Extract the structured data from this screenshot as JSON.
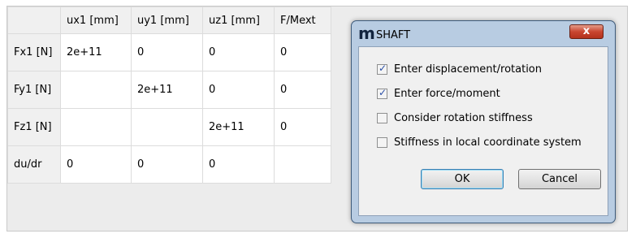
{
  "grid": {
    "columns": [
      "ux1 [mm]",
      "uy1 [mm]",
      "uz1 [mm]",
      "F/Mext"
    ],
    "rows": [
      {
        "label": "Fx1 [N]",
        "cells": [
          "2e+11",
          "0",
          "0",
          "0"
        ]
      },
      {
        "label": "Fy1 [N]",
        "cells": [
          "",
          "2e+11",
          "0",
          "0"
        ]
      },
      {
        "label": "Fz1 [N]",
        "cells": [
          "",
          "",
          "2e+11",
          "0"
        ]
      },
      {
        "label": "du/dr",
        "cells": [
          "0",
          "0",
          "0",
          ""
        ]
      }
    ]
  },
  "dialog": {
    "icon_glyph": "m",
    "title": "SHAFT",
    "close_glyph": "x",
    "options": [
      {
        "label": "Enter displacement/rotation",
        "checked": true
      },
      {
        "label": "Enter force/moment",
        "checked": true
      },
      {
        "label": "Consider rotation stiffness",
        "checked": false
      },
      {
        "label": "Stiffness in local coordinate system",
        "checked": false
      }
    ],
    "ok_label": "OK",
    "cancel_label": "Cancel"
  },
  "colors": {
    "window_frame": "#b8cce2",
    "close_button": "#c94630",
    "checkmark": "#2a4fa7"
  }
}
